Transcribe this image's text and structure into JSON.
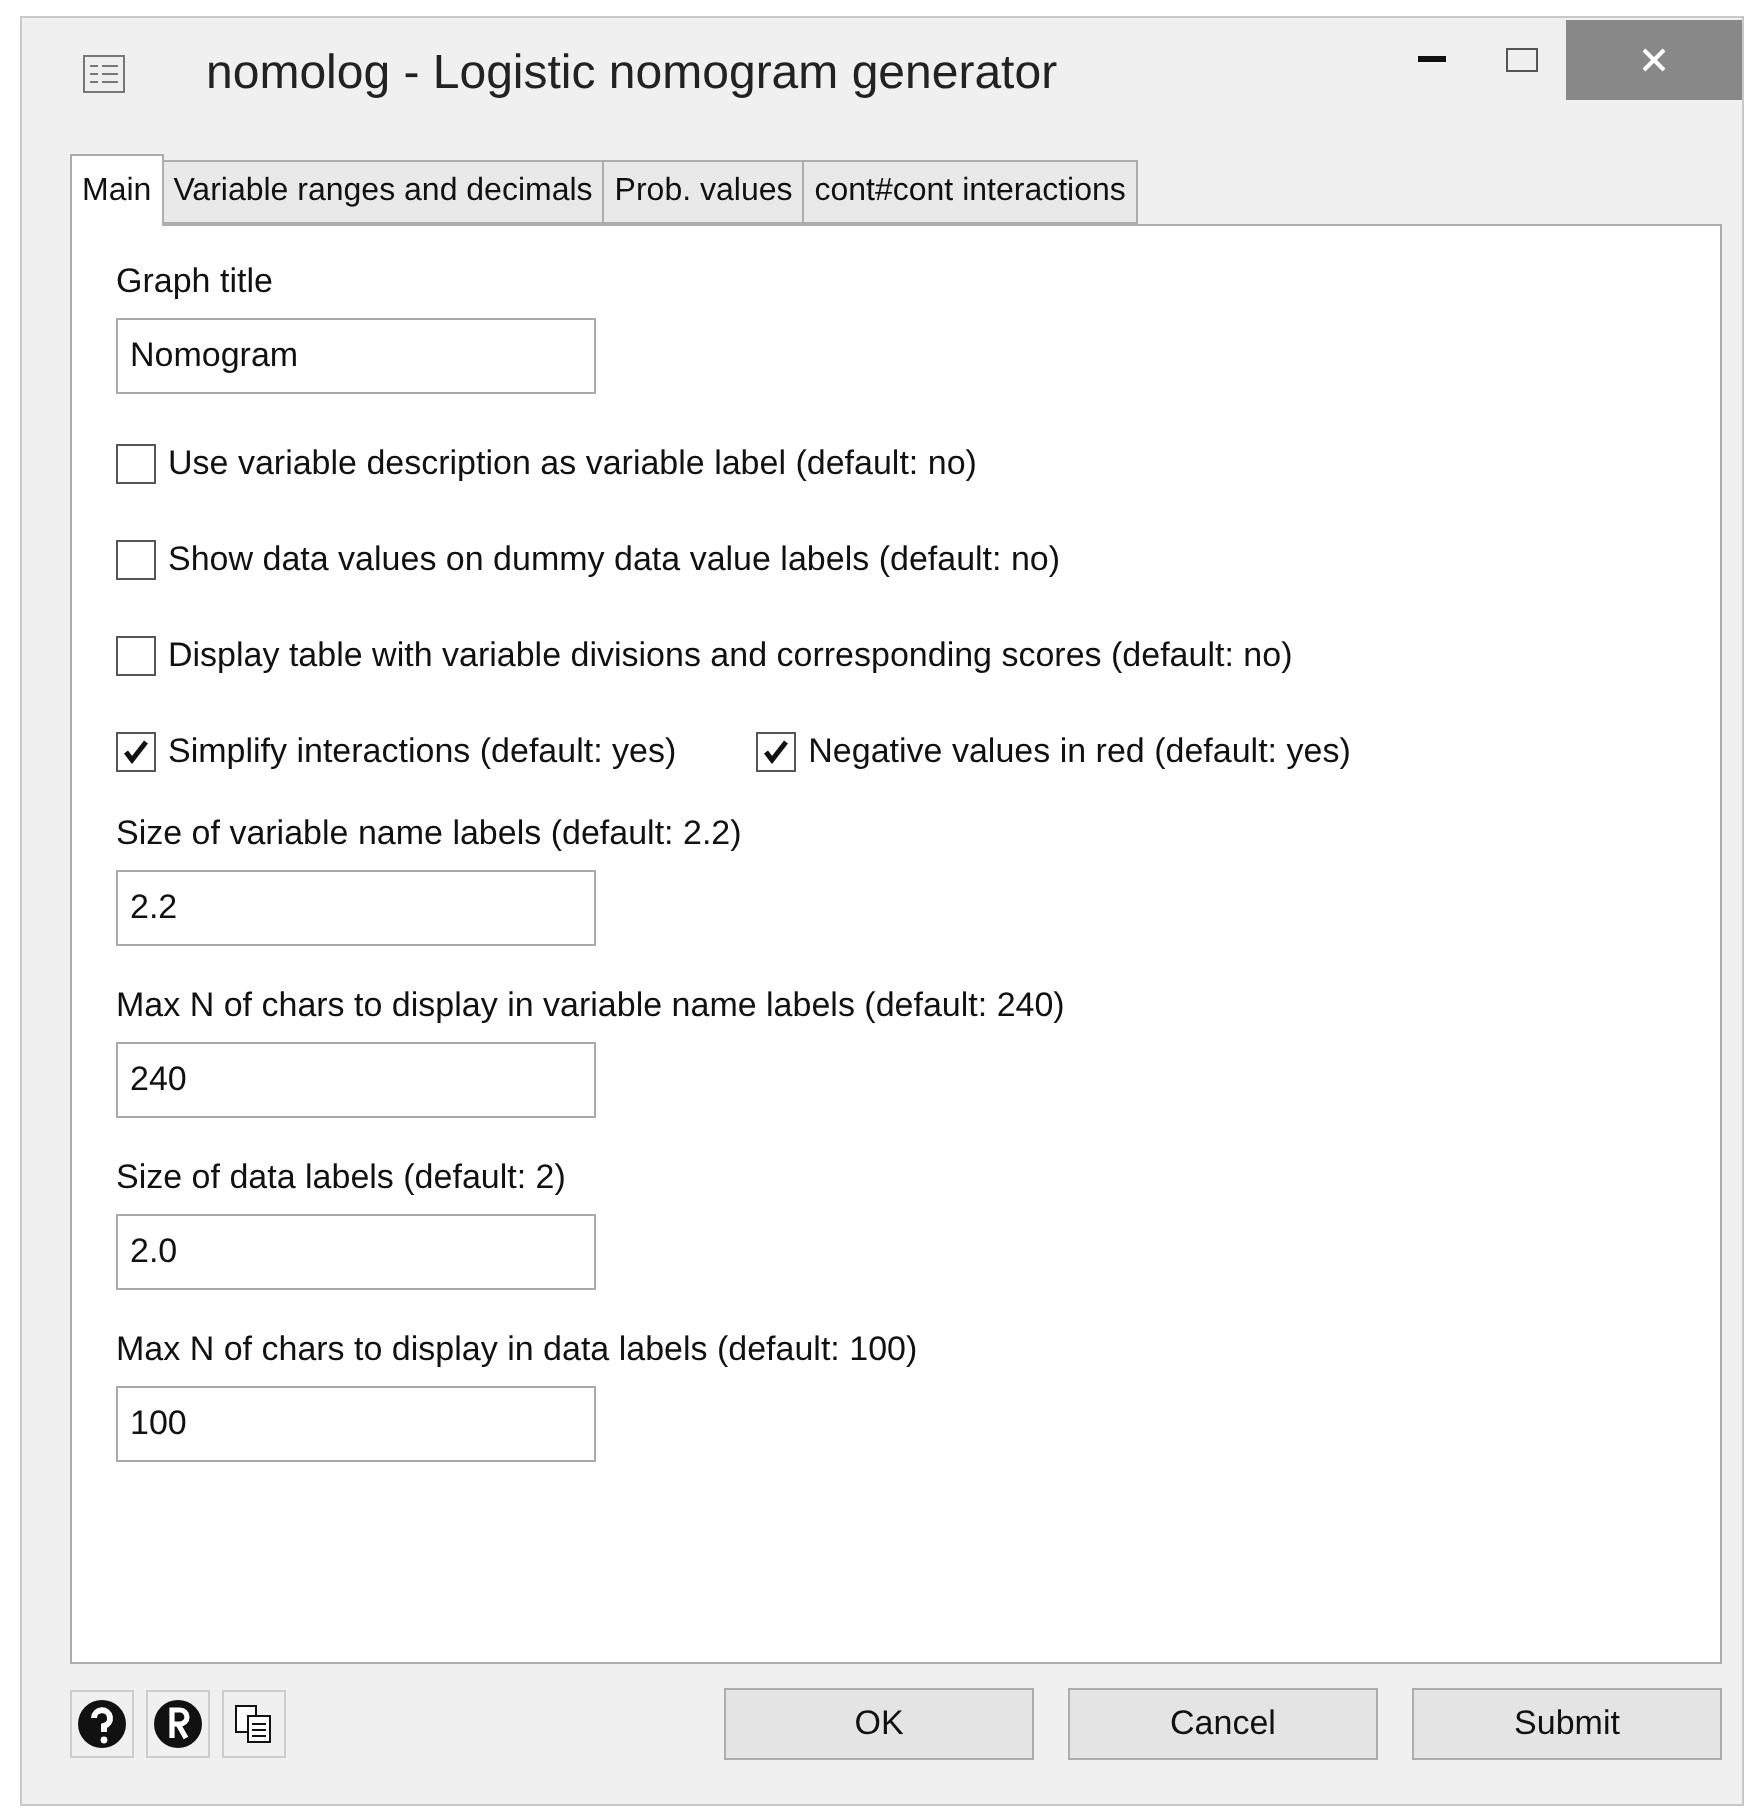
{
  "window": {
    "title": "nomolog - Logistic nomogram generator"
  },
  "tabs": [
    {
      "label": "Main",
      "selected": true
    },
    {
      "label": "Variable ranges and decimals",
      "selected": false
    },
    {
      "label": "Prob. values",
      "selected": false
    },
    {
      "label": "cont#cont interactions",
      "selected": false
    }
  ],
  "graph_title": {
    "label": "Graph title",
    "value": "Nomogram"
  },
  "checkboxes": [
    {
      "label": "Use variable description as variable label (default: no)",
      "checked": false
    },
    {
      "label": "Show data values on dummy data value labels (default: no)",
      "checked": false
    },
    {
      "label": "Display table with variable divisions and corresponding scores (default: no)",
      "checked": false
    }
  ],
  "checkbox_row": [
    {
      "label": "Simplify interactions (default: yes)",
      "checked": true
    },
    {
      "label": "Negative values in red (default: yes)",
      "checked": true
    }
  ],
  "fields": [
    {
      "label": "Size of variable name labels (default: 2.2)",
      "value": "2.2"
    },
    {
      "label": "Max N of chars to display in variable name labels (default: 240)",
      "value": "240"
    },
    {
      "label": "Size of data labels (default: 2)",
      "value": "2.0"
    },
    {
      "label": "Max N of chars to display in data labels (default: 100)",
      "value": "100"
    }
  ],
  "buttons": [
    "OK",
    "Cancel",
    "Submit"
  ]
}
